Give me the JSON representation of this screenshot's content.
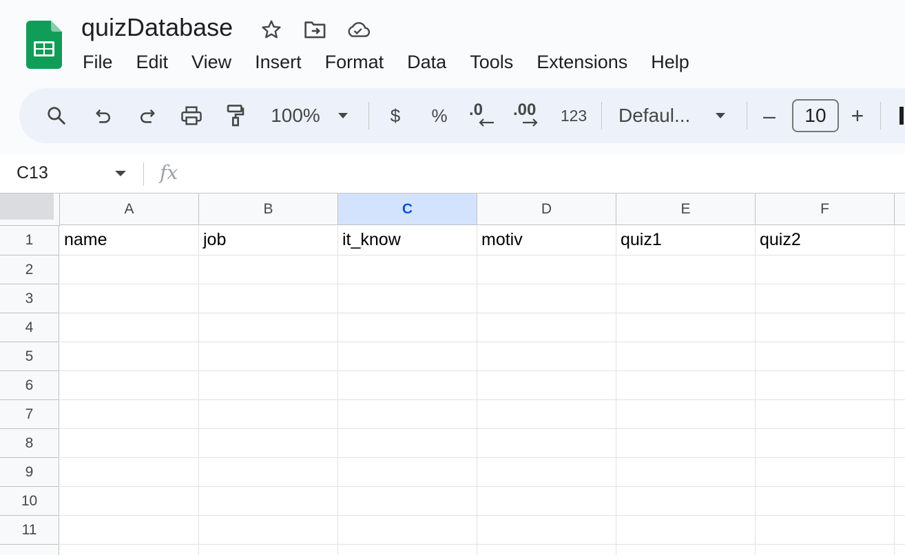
{
  "document": {
    "title": "quizDatabase"
  },
  "menu": [
    "File",
    "Edit",
    "View",
    "Insert",
    "Format",
    "Data",
    "Tools",
    "Extensions",
    "Help"
  ],
  "toolbar": {
    "zoom": "100%",
    "currency": "$",
    "percent": "%",
    "decrease_decimal": ".0",
    "increase_decimal": ".00",
    "number_format": "123",
    "font": "Defaul...",
    "font_size": "10",
    "minus": "–",
    "plus": "+"
  },
  "formula_bar": {
    "name_box": "C13",
    "fx": "fx",
    "value": ""
  },
  "sheet": {
    "columns": [
      "A",
      "B",
      "C",
      "D",
      "E",
      "F"
    ],
    "selected_column": "C",
    "rows": [
      "1",
      "2",
      "3",
      "4",
      "5",
      "6",
      "7",
      "8",
      "9",
      "10",
      "11"
    ],
    "header_row": [
      "name",
      "job",
      "it_know",
      "motiv",
      "quiz1",
      "quiz2"
    ]
  },
  "colors": {
    "sheets_green": "#0f9d58",
    "selection_blue": "#d3e3fd",
    "selection_text": "#0b57d0"
  }
}
